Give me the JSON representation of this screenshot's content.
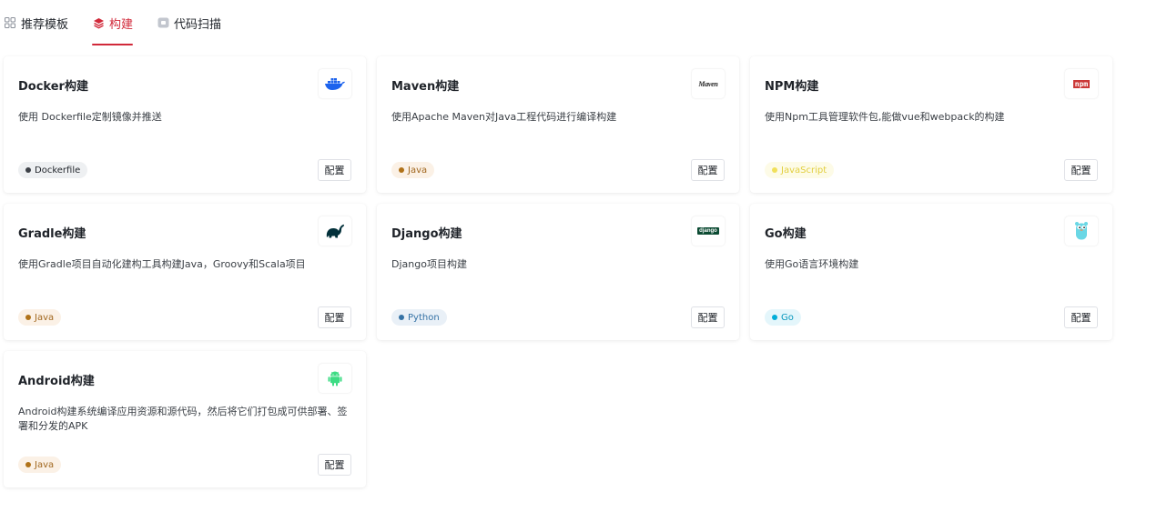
{
  "tabs": [
    {
      "label": "推荐模板",
      "icon": "grid-icon",
      "active": false
    },
    {
      "label": "构建",
      "icon": "layers-icon",
      "active": true
    },
    {
      "label": "代码扫描",
      "icon": "scan-icon",
      "active": false
    }
  ],
  "cards": [
    {
      "title": "Docker构建",
      "logo": "docker-logo",
      "description": "使用 Dockerfile定制镜像并推送",
      "tag": "Dockerfile",
      "tag_dot_color": "#3d4147",
      "tag_bg": "#eef0f2",
      "tag_color": "#1f2329",
      "button": "配置"
    },
    {
      "title": "Maven构建",
      "logo": "maven-logo",
      "logo_text": "Maven",
      "description": "使用Apache Maven对Java工程代码进行编译构建",
      "tag": "Java",
      "tag_dot_color": "#b07219",
      "tag_bg": "#fbf1e6",
      "tag_color": "#a0661d",
      "button": "配置"
    },
    {
      "title": "NPM构建",
      "logo": "npm-logo",
      "logo_text": "npm",
      "description": "使用Npm工具管理软件包,能做vue和webpack的构建",
      "tag": "JavaScript",
      "tag_dot_color": "#f1e05a",
      "tag_bg": "#fdfbe7",
      "tag_color": "#e2cf3f",
      "button": "配置"
    },
    {
      "title": "Gradle构建",
      "logo": "gradle-logo",
      "description": "使用Gradle项目自动化建构工具构建Java，Groovy和Scala项目",
      "tag": "Java",
      "tag_dot_color": "#b07219",
      "tag_bg": "#fbf1e6",
      "tag_color": "#a0661d",
      "button": "配置"
    },
    {
      "title": "Django构建",
      "logo": "django-logo",
      "logo_text": "django",
      "description": "Django项目构建",
      "tag": "Python",
      "tag_dot_color": "#3572a5",
      "tag_bg": "#e9f0f7",
      "tag_color": "#3572a5",
      "button": "配置"
    },
    {
      "title": "Go构建",
      "logo": "go-logo",
      "description": "使用Go语言环境构建",
      "tag": "Go",
      "tag_dot_color": "#00add8",
      "tag_bg": "#e4f6fb",
      "tag_color": "#0898bd",
      "button": "配置"
    },
    {
      "title": "Android构建",
      "logo": "android-logo",
      "description": "Android构建系统编译应用资源和源代码，然后将它们打包成可供部署、签署和分发的APK",
      "tag": "Java",
      "tag_dot_color": "#b07219",
      "tag_bg": "#fbf1e6",
      "tag_color": "#a0661d",
      "button": "配置"
    }
  ],
  "colors": {
    "accent": "#d1293a"
  }
}
